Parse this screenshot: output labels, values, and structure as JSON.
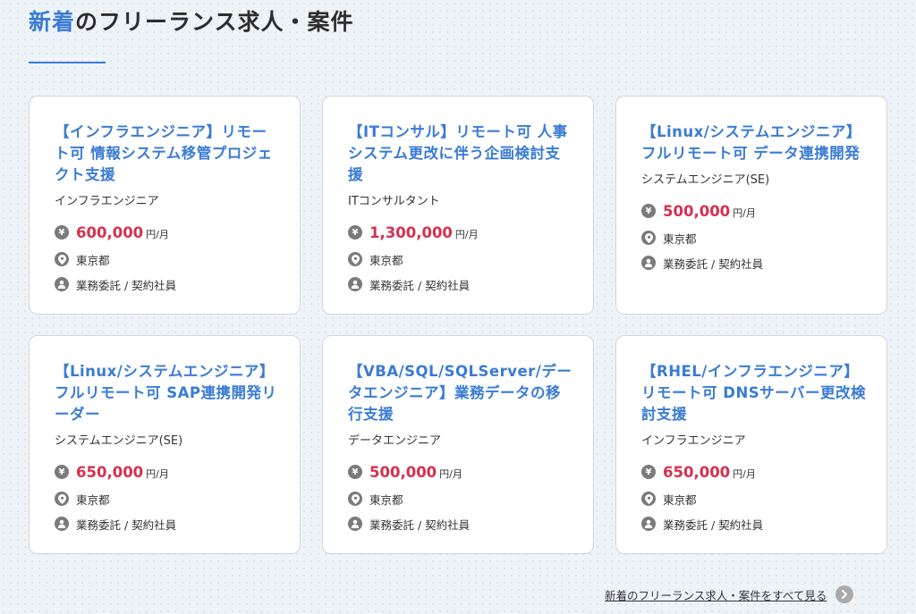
{
  "section": {
    "title_accent": "新着",
    "title_rest": "のフリーランス求人・案件"
  },
  "jobs": [
    {
      "title": "【インフラエンジニア】リモート可 情報システム移管プロジェクト支援",
      "role": "インフラエンジニア",
      "price": "600,000",
      "unit": "円/月",
      "location": "東京都",
      "contract": "業務委託 / 契約社員"
    },
    {
      "title": "【ITコンサル】リモート可 人事システム更改に伴う企画検討支援",
      "role": "ITコンサルタント",
      "price": "1,300,000",
      "unit": "円/月",
      "location": "東京都",
      "contract": "業務委託 / 契約社員"
    },
    {
      "title": "【Linux/システムエンジニア】フルリモート可 データ連携開発",
      "role": "システムエンジニア(SE)",
      "price": "500,000",
      "unit": "円/月",
      "location": "東京都",
      "contract": "業務委託 / 契約社員"
    },
    {
      "title": "【Linux/システムエンジニア】フルリモート可 SAP連携開発リーダー",
      "role": "システムエンジニア(SE)",
      "price": "650,000",
      "unit": "円/月",
      "location": "東京都",
      "contract": "業務委託 / 契約社員"
    },
    {
      "title": "【VBA/SQL/SQLServer/データエンジニア】業務データの移行支援",
      "role": "データエンジニア",
      "price": "500,000",
      "unit": "円/月",
      "location": "東京都",
      "contract": "業務委託 / 契約社員"
    },
    {
      "title": "【RHEL/インフラエンジニア】リモート可 DNSサーバー更改検討支援",
      "role": "インフラエンジニア",
      "price": "650,000",
      "unit": "円/月",
      "location": "東京都",
      "contract": "業務委託 / 契約社員"
    }
  ],
  "icons": {
    "price": "yen-icon",
    "location": "map-pin-icon",
    "contract": "user-icon",
    "more": "chevron-right-icon"
  },
  "yen_symbol": "¥",
  "see_all": {
    "label": "新着のフリーランス求人・案件をすべて見る"
  },
  "colors": {
    "accent": "#3a7bd5",
    "price": "#d6304f",
    "icon": "#7a7a7a"
  }
}
